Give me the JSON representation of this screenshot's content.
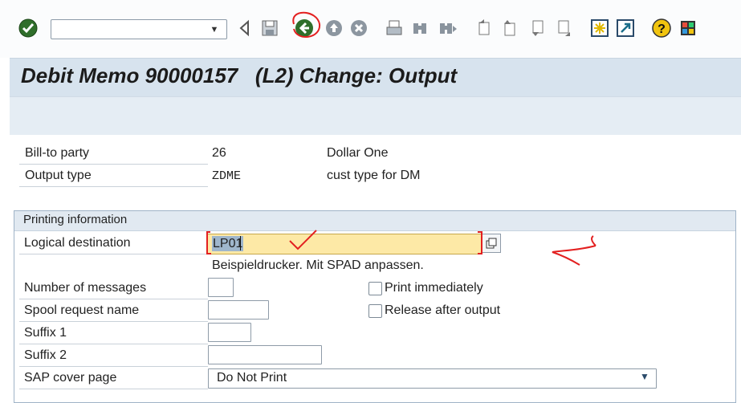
{
  "window": {
    "title": "Debit Memo 90000157   (L2) Change: Output"
  },
  "toolbar": {
    "command_field_value": "",
    "icons": [
      "enter-icon",
      "dropdown-arrow-icon",
      "back-triangle-icon",
      "save-icon",
      "back-icon",
      "exit-icon",
      "cancel-icon",
      "print-icon",
      "find-icon",
      "find-next-icon",
      "first-page-icon",
      "previous-page-icon",
      "next-page-icon",
      "last-page-icon",
      "create-session-icon",
      "shortcut-icon",
      "help-icon",
      "customize-layout-icon"
    ],
    "accent": "#2f6e2a"
  },
  "header": {
    "bill_to_label": "Bill-to party",
    "bill_to_number": "26",
    "bill_to_name": "Dollar One",
    "output_type_label": "Output type",
    "output_type_code": "ZDME",
    "output_type_desc": "cust type for DM"
  },
  "printing": {
    "section_title": "Printing information",
    "logical_dest_label": "Logical destination",
    "logical_dest_value": "LP01",
    "logical_dest_desc": "Beispieldrucker. Mit SPAD anpassen.",
    "num_messages_label": "Number of messages",
    "num_messages_value": "",
    "spool_label": "Spool request name",
    "spool_value": "",
    "suffix1_label": "Suffix 1",
    "suffix1_value": "",
    "suffix2_label": "Suffix 2",
    "suffix2_value": "",
    "cover_page_label": "SAP cover page",
    "cover_page_value": "Do Not Print",
    "print_immediately_label": "Print immediately",
    "print_immediately_checked": false,
    "release_after_output_label": "Release after output",
    "release_after_output_checked": false
  },
  "annotations": {
    "color": "#e32020"
  }
}
